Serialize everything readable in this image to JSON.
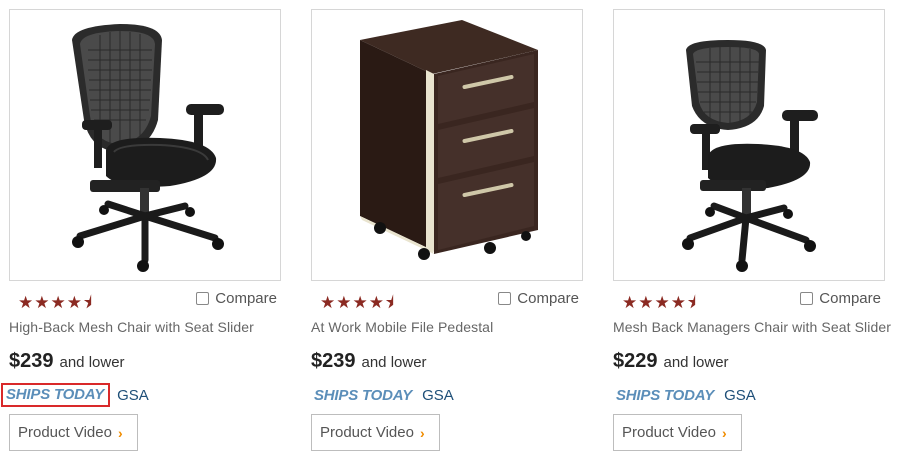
{
  "colors": {
    "star": "#8b2a22",
    "ships_today": "#5b8eb9",
    "gsa": "#1e4f78",
    "chevron": "#f08c00",
    "highlight_border": "#d9292a"
  },
  "products": [
    {
      "image": "high-back-mesh-chair",
      "stars": "★★★★⯨",
      "rating": 4.5,
      "compare_label": "Compare",
      "title": "High-Back Mesh Chair with Seat Slider",
      "price": "$239",
      "price_suffix": "and lower",
      "ships_label": "SHIPS TODAY",
      "gsa_label": "GSA",
      "video_label": "Product Video",
      "video_icon": "chevron-right-icon"
    },
    {
      "image": "mobile-file-pedestal",
      "stars": "★★★★⯨",
      "rating": 4.5,
      "compare_label": "Compare",
      "title": "At Work Mobile File Pedestal",
      "price": "$239",
      "price_suffix": "and lower",
      "ships_label": "SHIPS TODAY",
      "gsa_label": "GSA",
      "video_label": "Product Video",
      "video_icon": "chevron-right-icon"
    },
    {
      "image": "mesh-back-managers-chair",
      "stars": "★★★★⯨",
      "rating": 4.5,
      "compare_label": "Compare",
      "title": "Mesh Back Managers Chair with Seat Slider",
      "price": "$229",
      "price_suffix": "and lower",
      "ships_label": "SHIPS TODAY",
      "gsa_label": "GSA",
      "video_label": "Product Video",
      "video_icon": "chevron-right-icon"
    }
  ]
}
